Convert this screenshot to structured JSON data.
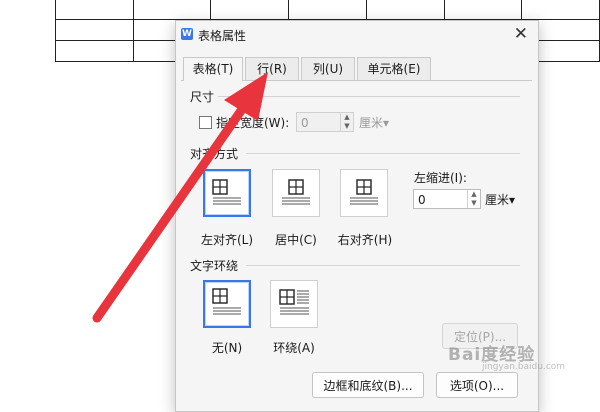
{
  "dialog": {
    "title": "表格属性",
    "app_icon": "W",
    "tabs": [
      {
        "label": "表格(T)"
      },
      {
        "label": "行(R)"
      },
      {
        "label": "列(U)"
      },
      {
        "label": "单元格(E)"
      }
    ],
    "size_section": {
      "title": "尺寸",
      "checkbox_label": "指定宽度(W):",
      "checkbox_checked": false,
      "width_value": "0",
      "unit": "厘米▾"
    },
    "alignment_section": {
      "title": "对齐方式",
      "options": [
        {
          "label": "左对齐(L)",
          "selected": true
        },
        {
          "label": "居中(C)",
          "selected": false
        },
        {
          "label": "右对齐(H)",
          "selected": false
        }
      ],
      "indent_label": "左缩进(I):",
      "indent_value": "0",
      "indent_unit": "厘米▾"
    },
    "wrap_section": {
      "title": "文字环绕",
      "options": [
        {
          "label": "无(N)",
          "selected": true
        },
        {
          "label": "环绕(A)",
          "selected": false
        }
      ]
    },
    "buttons": {
      "position": "定位(P)...",
      "borders": "边框和底纹(B)...",
      "options": "选项(O)..."
    }
  },
  "watermark": {
    "text": "Bai度经验",
    "sub": "jingyan.baidu.com"
  },
  "colors": {
    "accent": "#3b78e7",
    "arrow": "#e8343d"
  }
}
